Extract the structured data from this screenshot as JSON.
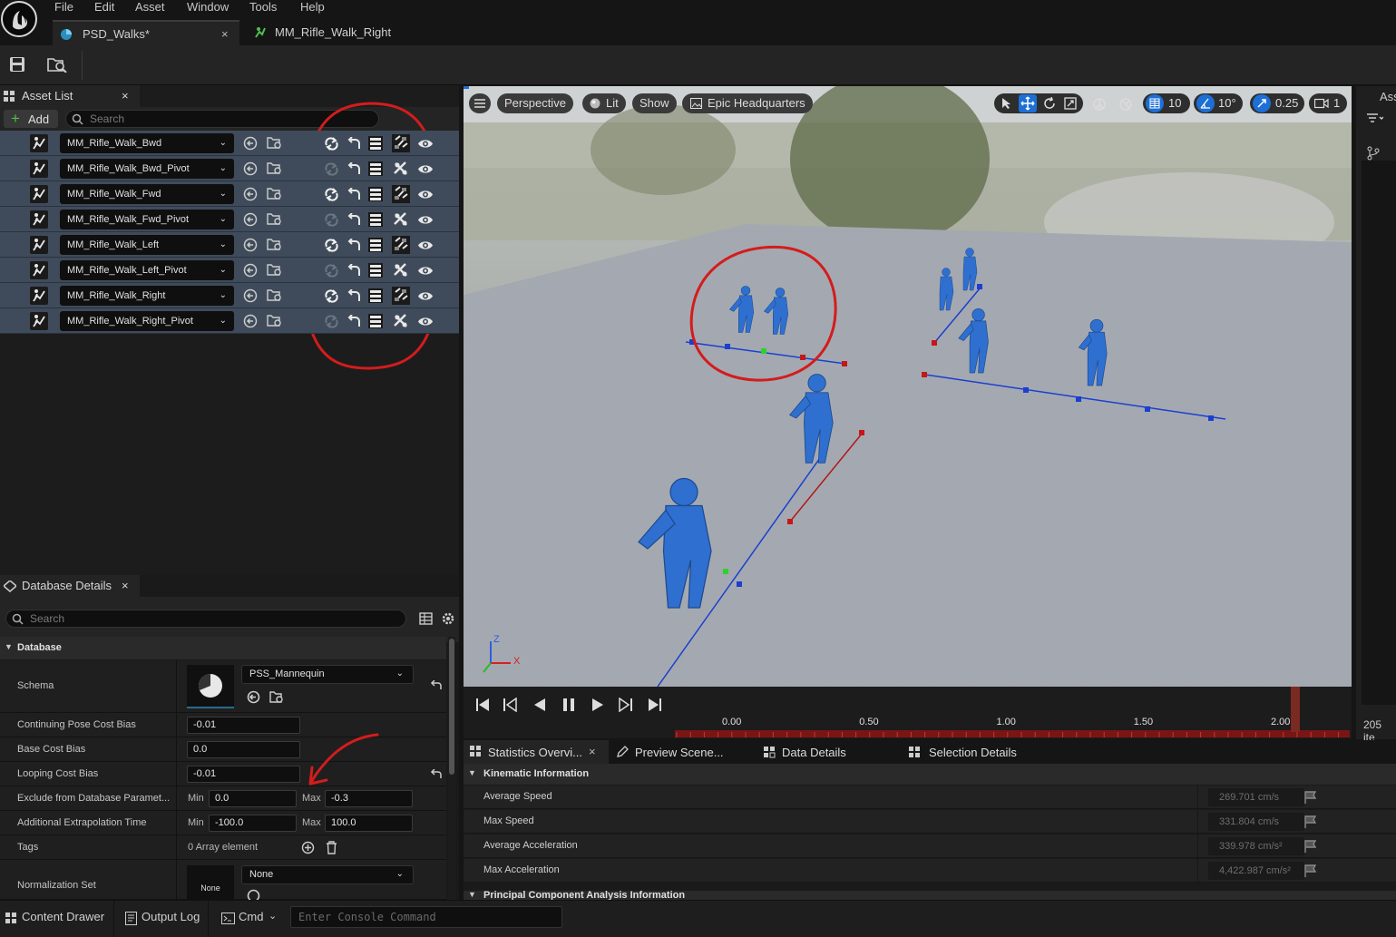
{
  "menu": [
    "File",
    "Edit",
    "Asset",
    "Window",
    "Tools",
    "Help"
  ],
  "tabs": [
    {
      "label": "PSD_Walks*",
      "active": true
    },
    {
      "label": "MM_Rifle_Walk_Right",
      "active": false
    }
  ],
  "tab_close": "×",
  "asset_list": {
    "title": "Asset List",
    "add_label": "Add",
    "search_placeholder": "Search",
    "items": [
      {
        "name": "MM_Rifle_Walk_Bwd",
        "loop_enabled": true,
        "mirror_icon": "mirror-grid-icon"
      },
      {
        "name": "MM_Rifle_Walk_Bwd_Pivot",
        "loop_enabled": false,
        "mirror_icon": "mirror-cross-icon"
      },
      {
        "name": "MM_Rifle_Walk_Fwd",
        "loop_enabled": true,
        "mirror_icon": "mirror-grid-icon"
      },
      {
        "name": "MM_Rifle_Walk_Fwd_Pivot",
        "loop_enabled": false,
        "mirror_icon": "mirror-cross-icon"
      },
      {
        "name": "MM_Rifle_Walk_Left",
        "loop_enabled": true,
        "mirror_icon": "mirror-grid-icon"
      },
      {
        "name": "MM_Rifle_Walk_Left_Pivot",
        "loop_enabled": false,
        "mirror_icon": "mirror-cross-icon"
      },
      {
        "name": "MM_Rifle_Walk_Right",
        "loop_enabled": true,
        "mirror_icon": "mirror-grid-icon"
      },
      {
        "name": "MM_Rifle_Walk_Right_Pivot",
        "loop_enabled": false,
        "mirror_icon": "mirror-cross-icon"
      }
    ]
  },
  "details": {
    "title": "Database Details",
    "search_placeholder": "Search",
    "section": "Database",
    "schema_label": "Schema",
    "schema_value": "PSS_Mannequin",
    "rows": {
      "continuing_pose_cost_bias": {
        "label": "Continuing Pose Cost Bias",
        "value": "-0.01"
      },
      "base_cost_bias": {
        "label": "Base Cost Bias",
        "value": "0.0"
      },
      "looping_cost_bias": {
        "label": "Looping Cost Bias",
        "value": "-0.01"
      },
      "exclude": {
        "label": "Exclude from Database Paramet...",
        "min_label": "Min",
        "min": "0.0",
        "max_label": "Max",
        "max": "-0.3"
      },
      "extrapolation": {
        "label": "Additional Extrapolation Time",
        "min_label": "Min",
        "min": "-100.0",
        "max_label": "Max",
        "max": "100.0"
      },
      "tags": {
        "label": "Tags",
        "value": "0 Array element"
      },
      "normalization": {
        "label": "Normalization Set",
        "thumb": "None",
        "value": "None"
      }
    }
  },
  "viewport": {
    "perspective": "Perspective",
    "lit": "Lit",
    "show": "Show",
    "environment": "Epic Headquarters",
    "grid_snap": "10",
    "rotation_snap": "10°",
    "scale_snap": "0.25",
    "camera_speed": "1",
    "axis_z": "Z",
    "axis_x": "X"
  },
  "timeline": {
    "ticks": [
      "0.00",
      "0.50",
      "1.00",
      "1.50",
      "2.00"
    ],
    "playhead_fraction": 0.92
  },
  "bottom_tabs": [
    "Statistics Overvi...",
    "Preview Scene...",
    "Data Details",
    "Selection Details"
  ],
  "statistics": {
    "section": "Kinematic Information",
    "rows": [
      {
        "label": "Average Speed",
        "value": "269.701 cm/s"
      },
      {
        "label": "Max Speed",
        "value": "331.804 cm/s"
      },
      {
        "label": "Average Acceleration",
        "value": "339.978 cm/s²"
      },
      {
        "label": "Max Acceleration",
        "value": "4,422.987 cm/s²"
      }
    ],
    "next_section": "Principal Component Analysis Information"
  },
  "right_strip": {
    "title": "Ass",
    "count": "205 ite"
  },
  "statusbar": {
    "content_drawer": "Content Drawer",
    "output_log": "Output Log",
    "cmd": "Cmd",
    "console_placeholder": "Enter Console Command"
  },
  "colors": {
    "annotation_red": "#d41c1c",
    "selected_row": "#3f4b5a",
    "accent_blue": "#1d6fd6"
  }
}
